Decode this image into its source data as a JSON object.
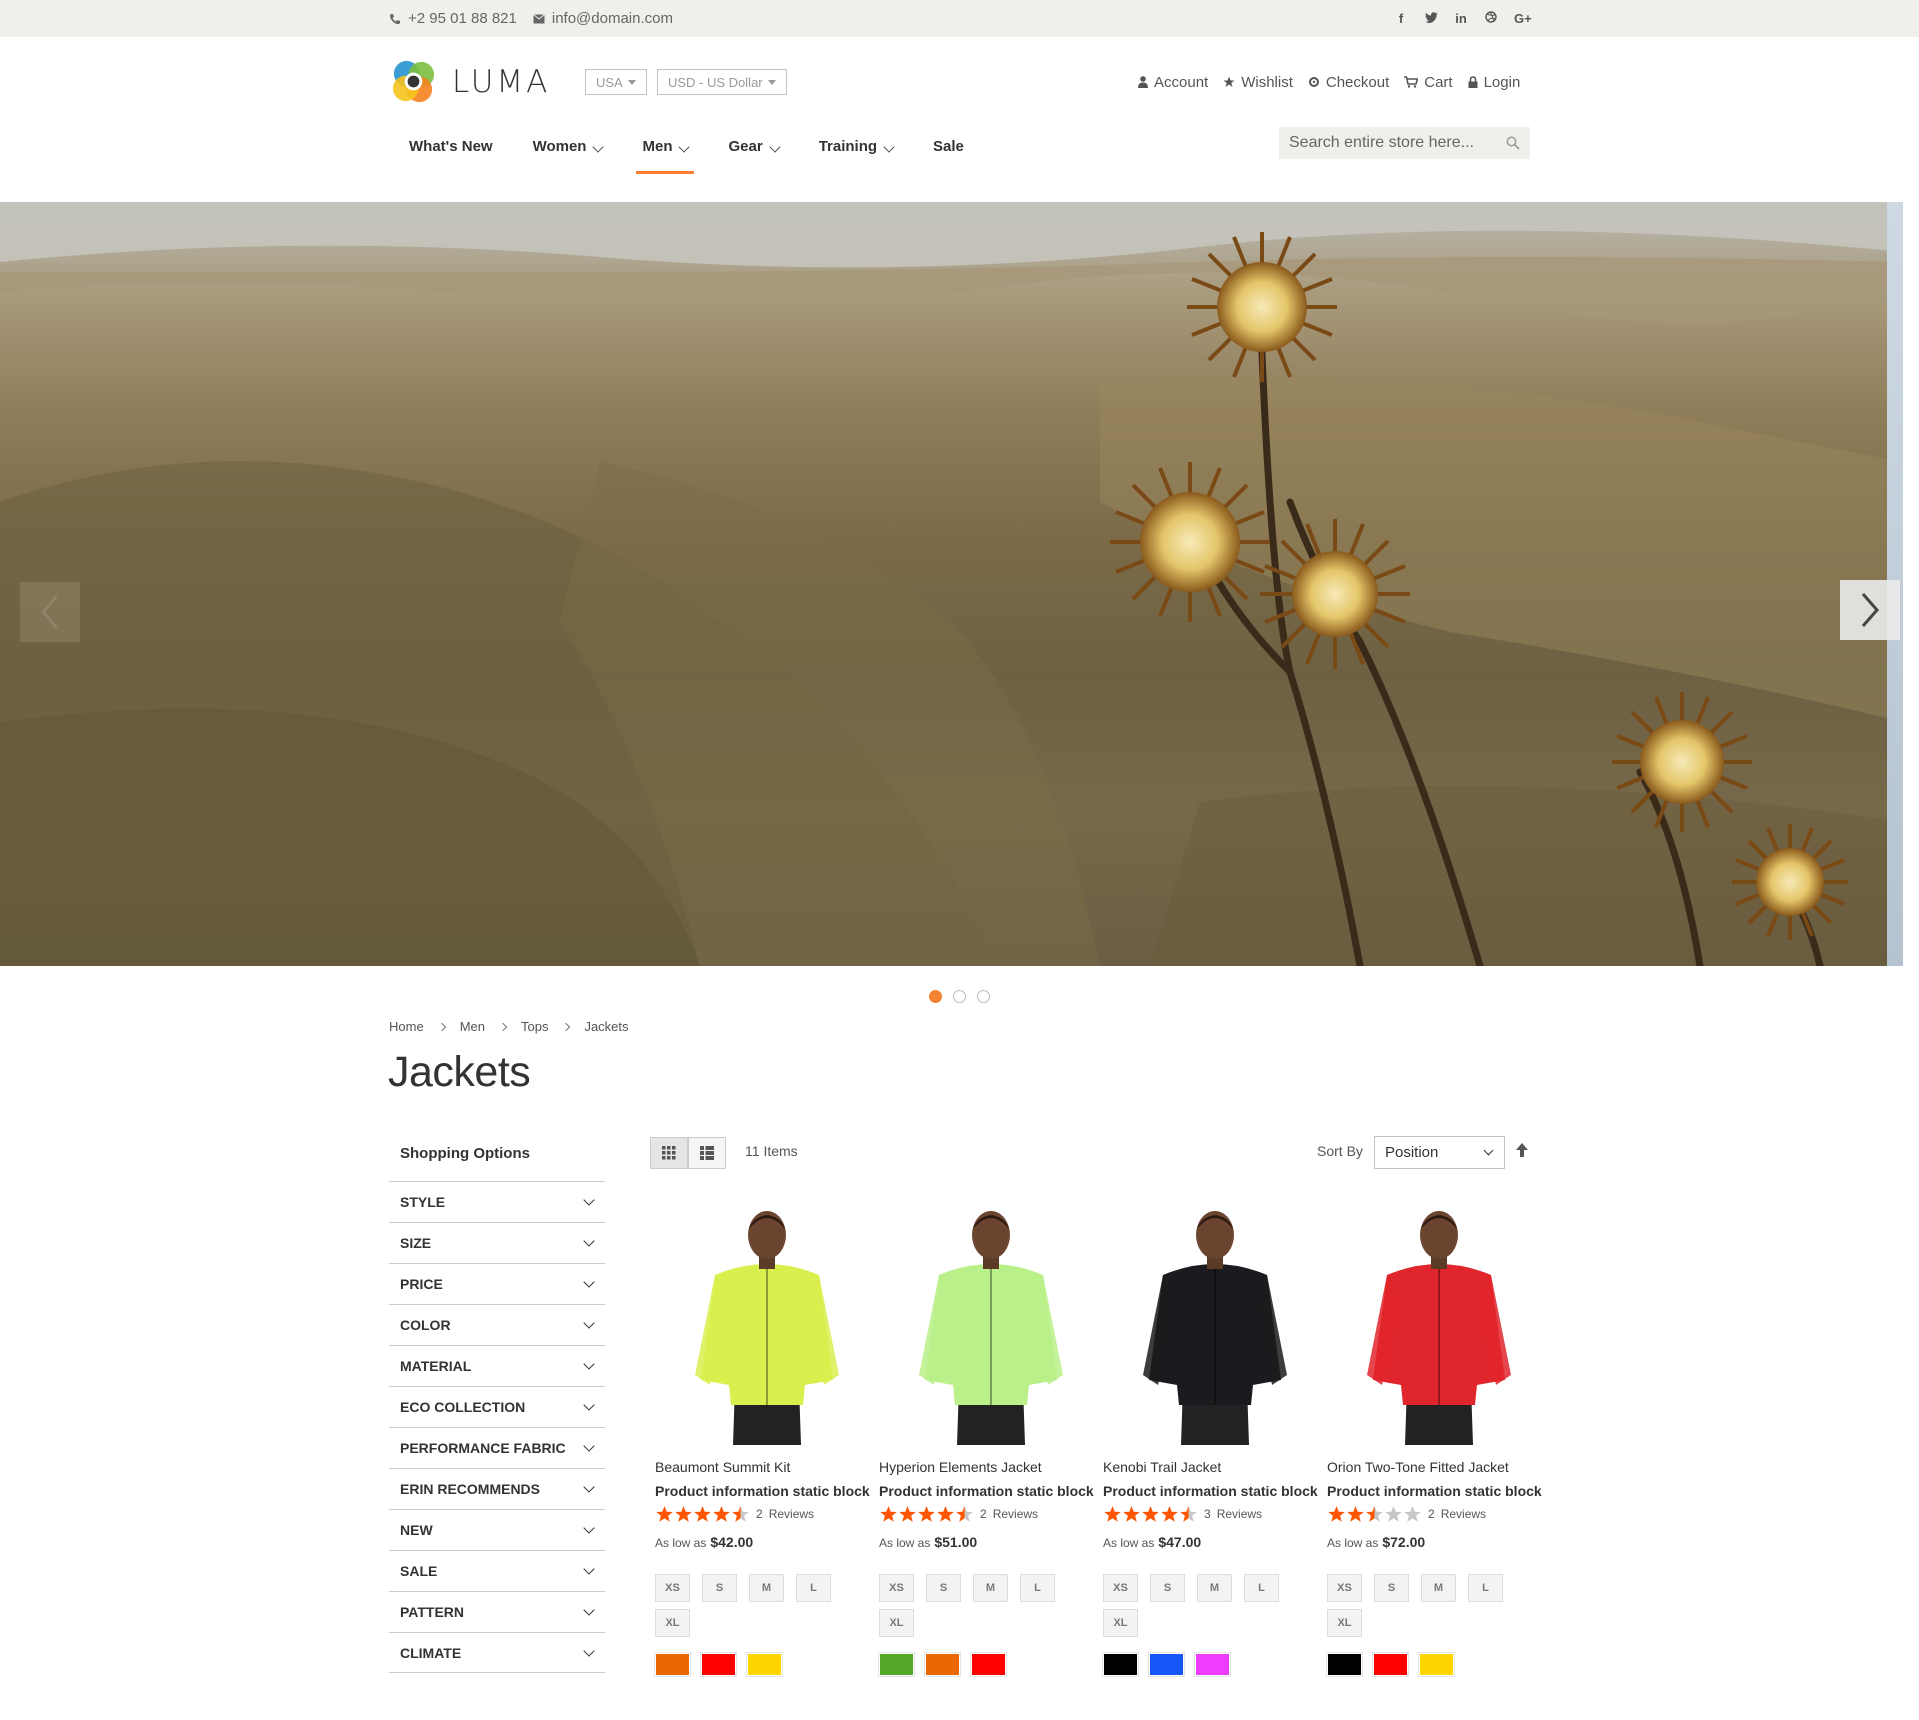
{
  "topbar": {
    "phone": "+2 95 01 88 821",
    "email": "info@domain.com",
    "social": [
      "f",
      "t",
      "in",
      "dr",
      "G+"
    ]
  },
  "header": {
    "logo_text": "LUMA",
    "country": "USA",
    "currency": "USD - US Dollar",
    "links": {
      "account": "Account",
      "wishlist": "Wishlist",
      "checkout": "Checkout",
      "cart": "Cart",
      "login": "Login"
    },
    "search_placeholder": "Search entire store here..."
  },
  "nav": [
    {
      "label": "What's New",
      "dropdown": false
    },
    {
      "label": "Women",
      "dropdown": true
    },
    {
      "label": "Men",
      "dropdown": true,
      "active": true
    },
    {
      "label": "Gear",
      "dropdown": true
    },
    {
      "label": "Training",
      "dropdown": true
    },
    {
      "label": "Sale",
      "dropdown": false
    }
  ],
  "slider": {
    "slides": 3,
    "active": 1
  },
  "breadcrumb": [
    "Home",
    "Men",
    "Tops",
    "Jackets"
  ],
  "page_title": "Jackets",
  "sidebar": {
    "title": "Shopping Options",
    "filters": [
      "STYLE",
      "SIZE",
      "PRICE",
      "COLOR",
      "MATERIAL",
      "ECO COLLECTION",
      "PERFORMANCE FABRIC",
      "ERIN RECOMMENDS",
      "NEW",
      "SALE",
      "PATTERN",
      "CLIMATE"
    ]
  },
  "toolbar": {
    "items_count": "11",
    "items_label": "Items",
    "sort_label": "Sort By",
    "sort_value": "Position"
  },
  "products": [
    {
      "name": "Beaumont Summit Kit",
      "info": "Product information static block",
      "rating": 4.5,
      "reviews": "2",
      "reviews_label": "Reviews",
      "price_prefix": "As low as",
      "price": "$42.00",
      "sizes": [
        "XS",
        "S",
        "M",
        "L",
        "XL"
      ],
      "jacket_color": "#d9ef4e",
      "swatches": [
        "#eb6703",
        "#ff0000",
        "#ffd500"
      ]
    },
    {
      "name": "Hyperion Elements Jacket",
      "info": "Product information static block",
      "rating": 4.5,
      "reviews": "2",
      "reviews_label": "Reviews",
      "price_prefix": "As low as",
      "price": "$51.00",
      "sizes": [
        "XS",
        "S",
        "M",
        "L",
        "XL"
      ],
      "jacket_color": "#b9f08a",
      "swatches": [
        "#53a828",
        "#eb6703",
        "#ff0000"
      ]
    },
    {
      "name": "Kenobi Trail Jacket",
      "info": "Product information static block",
      "rating": 4.5,
      "reviews": "3",
      "reviews_label": "Reviews",
      "price_prefix": "As low as",
      "price": "$47.00",
      "sizes": [
        "XS",
        "S",
        "M",
        "L",
        "XL"
      ],
      "jacket_color": "#1b1b1f",
      "swatches": [
        "#000000",
        "#1857f7",
        "#ef3dff"
      ]
    },
    {
      "name": "Orion Two-Tone Fitted Jacket",
      "info": "Product information static block",
      "rating": 2.5,
      "reviews": "2",
      "reviews_label": "Reviews",
      "price_prefix": "As low as",
      "price": "$72.00",
      "sizes": [
        "XS",
        "S",
        "M",
        "L",
        "XL"
      ],
      "jacket_color": "#e0262c",
      "swatches": [
        "#000000",
        "#ff0000",
        "#ffd500"
      ]
    }
  ],
  "colors": {
    "accent": "#ff7e33",
    "star": "#ff5501",
    "star_empty": "#c7c7c7"
  }
}
